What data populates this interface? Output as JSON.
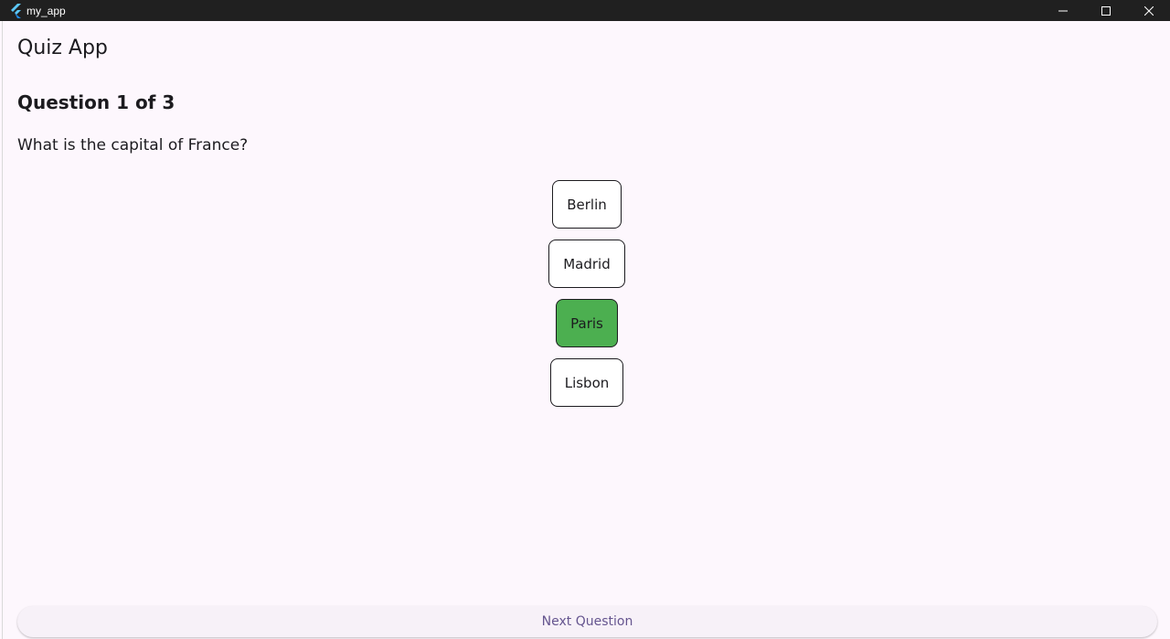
{
  "window": {
    "title": "my_app",
    "controls": {
      "minimize_icon": "minimize-icon",
      "maximize_icon": "maximize-icon",
      "close_icon": "close-icon"
    }
  },
  "appbar": {
    "title": "Quiz App"
  },
  "quiz": {
    "progress_label": "Question 1 of 3",
    "question": "What is the capital of France?",
    "answers": [
      {
        "label": "Berlin",
        "selected": false
      },
      {
        "label": "Madrid",
        "selected": false
      },
      {
        "label": "Paris",
        "selected": true
      },
      {
        "label": "Lisbon",
        "selected": false
      }
    ]
  },
  "footer": {
    "next_label": "Next Question"
  },
  "colors": {
    "selected_answer": "#4caf50",
    "background": "#fdf7fd",
    "next_button_text": "#65558f"
  }
}
